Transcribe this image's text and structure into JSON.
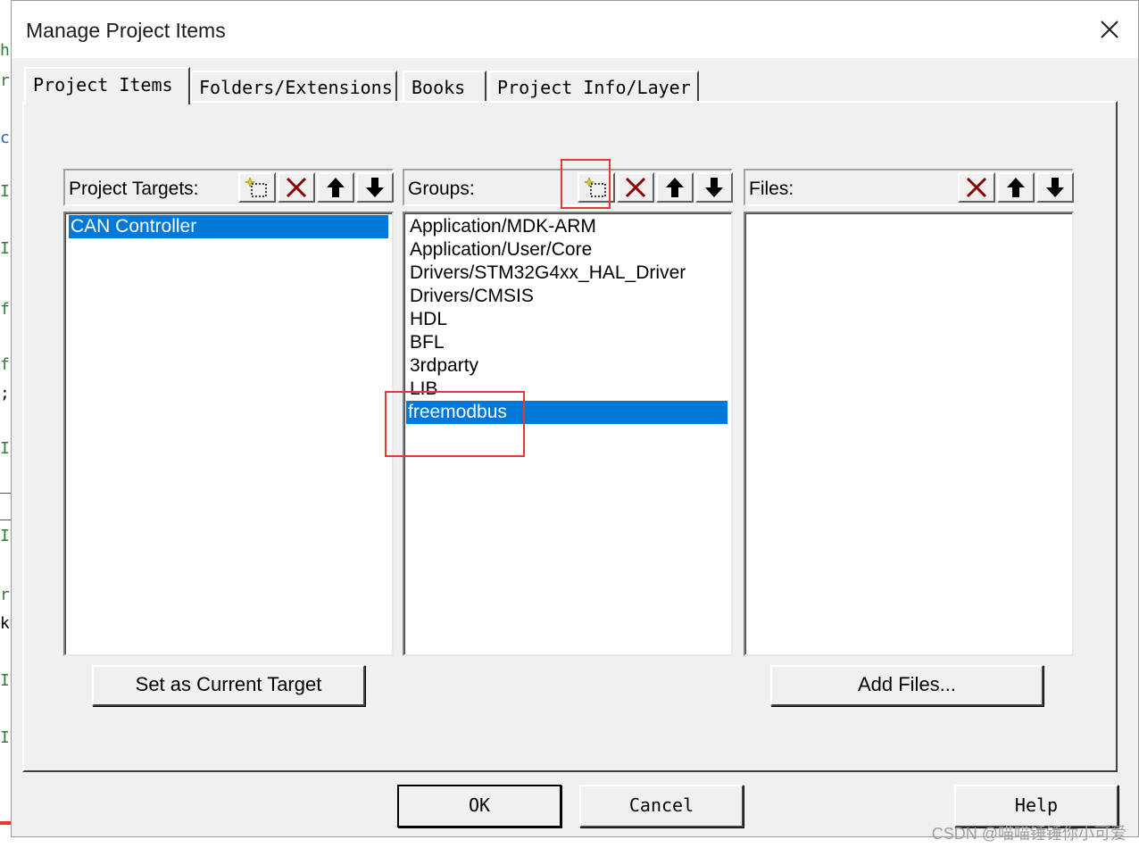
{
  "window": {
    "title": "Manage Project Items"
  },
  "tabs": [
    {
      "label": "Project Items",
      "active": true
    },
    {
      "label": "Folders/Extensions",
      "active": false
    },
    {
      "label": "Books",
      "active": false
    },
    {
      "label": "Project Info/Layer",
      "active": false
    }
  ],
  "targets": {
    "label": "Project Targets:",
    "items": [
      "CAN Controller"
    ],
    "selected": "CAN Controller",
    "set_current_label": "Set as Current Target"
  },
  "groups": {
    "label": "Groups:",
    "items": [
      "Application/MDK-ARM",
      "Application/User/Core",
      "Drivers/STM32G4xx_HAL_Driver",
      "Drivers/CMSIS",
      "HDL",
      "BFL",
      "3rdparty",
      "LIB",
      "freemodbus"
    ],
    "selected": "freemodbus"
  },
  "files": {
    "label": "Files:",
    "items": [],
    "add_files_label": "Add Files..."
  },
  "buttons": {
    "ok": "OK",
    "cancel": "Cancel",
    "help": "Help"
  },
  "watermark": "CSDN @喵喵锤锤你小可爱",
  "colors": {
    "selection": "#0078d7",
    "annotation": "#e53935",
    "delete_icon": "#8b0000"
  },
  "icons": [
    "close-icon",
    "new-item-icon",
    "delete-icon",
    "move-up-icon",
    "move-down-icon"
  ]
}
